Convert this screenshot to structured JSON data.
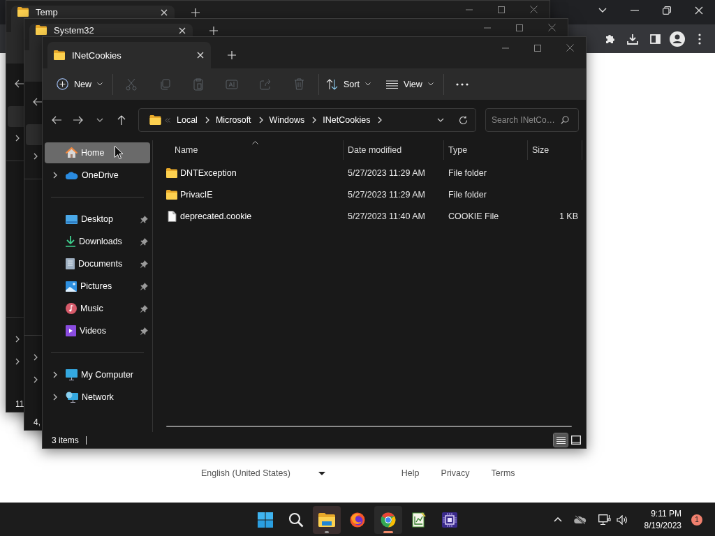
{
  "browser_page": {
    "language": "English (United States)",
    "links": [
      "Help",
      "Privacy",
      "Terms"
    ]
  },
  "explorer_windows": [
    {
      "title": "Temp",
      "status": "11"
    },
    {
      "title": "System32",
      "status": "4,"
    },
    {
      "title": "INetCookies",
      "toolbar": [
        {
          "items": [
            {
              "kind": "new",
              "label": "New",
              "menu": true,
              "disabled": false
            }
          ]
        },
        {
          "items": [
            {
              "kind": "cut",
              "disabled": true
            },
            {
              "kind": "copy",
              "disabled": true
            },
            {
              "kind": "paste",
              "disabled": true
            },
            {
              "kind": "rename",
              "disabled": true
            },
            {
              "kind": "share",
              "disabled": true
            },
            {
              "kind": "delete",
              "disabled": true
            }
          ]
        },
        {
          "items": [
            {
              "kind": "sort",
              "label": "Sort",
              "menu": true,
              "disabled": false
            },
            {
              "kind": "view",
              "label": "View",
              "menu": true,
              "disabled": false
            }
          ]
        },
        {
          "items": [
            {
              "kind": "more",
              "disabled": false
            }
          ]
        }
      ],
      "address": {
        "crumbs": [
          "Local",
          "Microsoft",
          "Windows",
          "INetCookies"
        ]
      },
      "search": {
        "placeholder": "Search INetCo…"
      },
      "sidebar": {
        "groups": [
          {
            "items": [
              {
                "label": "Home",
                "kind": "home",
                "expandable": false,
                "pinned": false,
                "selected": true
              },
              {
                "label": "OneDrive",
                "kind": "onedrive",
                "expandable": true,
                "pinned": false,
                "selected": false
              }
            ]
          },
          {
            "items": [
              {
                "label": "Desktop",
                "kind": "desktop",
                "expandable": false,
                "pinned": true,
                "selected": false
              },
              {
                "label": "Downloads",
                "kind": "downloads",
                "expandable": false,
                "pinned": true,
                "selected": false
              },
              {
                "label": "Documents",
                "kind": "documents",
                "expandable": false,
                "pinned": true,
                "selected": false
              },
              {
                "label": "Pictures",
                "kind": "pictures",
                "expandable": false,
                "pinned": true,
                "selected": false
              },
              {
                "label": "Music",
                "kind": "music",
                "expandable": false,
                "pinned": true,
                "selected": false
              },
              {
                "label": "Videos",
                "kind": "videos",
                "expandable": false,
                "pinned": true,
                "selected": false
              }
            ]
          },
          {
            "items": [
              {
                "label": "My Computer",
                "kind": "computer",
                "expandable": true,
                "pinned": false,
                "selected": false
              },
              {
                "label": "Network",
                "kind": "network",
                "expandable": true,
                "pinned": false,
                "selected": false
              }
            ]
          }
        ]
      },
      "columns": [
        {
          "label": "Name",
          "sorted": true
        },
        {
          "label": "Date modified",
          "sorted": false
        },
        {
          "label": "Type",
          "sorted": false
        },
        {
          "label": "Size",
          "sorted": false
        }
      ],
      "rows": [
        {
          "name": "DNTException",
          "kind": "folder",
          "date_modified": "5/27/2023 11:29 AM",
          "type": "File folder"
        },
        {
          "name": "PrivacIE",
          "kind": "folder",
          "date_modified": "5/27/2023 11:29 AM",
          "type": "File folder"
        },
        {
          "name": "deprecated.cookie",
          "kind": "file",
          "date_modified": "5/27/2023 11:40 AM",
          "type": "COOKIE File",
          "size": "1 KB"
        }
      ],
      "status": "3 items",
      "view_modes": [
        {
          "kind": "details",
          "selected": true
        },
        {
          "kind": "tiles",
          "selected": false
        }
      ]
    }
  ],
  "taskbar": {
    "apps": [
      {
        "kind": "start",
        "open": false,
        "active": false,
        "hovered": false
      },
      {
        "kind": "search",
        "open": false,
        "active": false,
        "hovered": false
      },
      {
        "kind": "explorer",
        "open": true,
        "active": false,
        "hovered": true
      },
      {
        "kind": "firefox",
        "open": false,
        "active": false,
        "hovered": false
      },
      {
        "kind": "chrome",
        "open": true,
        "active": true,
        "hovered": false
      },
      {
        "kind": "chart-editor",
        "open": false,
        "active": false,
        "hovered": false
      },
      {
        "kind": "chip",
        "open": false,
        "active": false,
        "hovered": false
      }
    ],
    "time": "9:11 PM",
    "date": "8/19/2023",
    "notifications": "1"
  }
}
